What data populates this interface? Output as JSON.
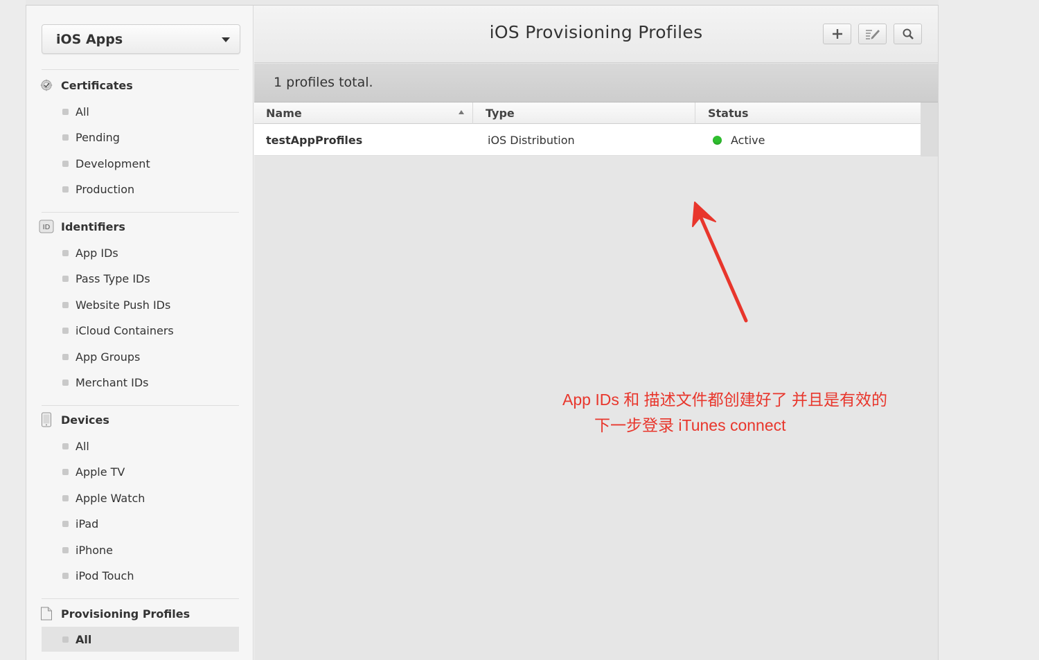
{
  "platform": {
    "selected": "iOS Apps"
  },
  "sidebar": {
    "sections": [
      {
        "title": "Certificates",
        "icon": "certificate-icon",
        "items": [
          "All",
          "Pending",
          "Development",
          "Production"
        ]
      },
      {
        "title": "Identifiers",
        "icon": "id-badge-icon",
        "icon_text": "ID",
        "items": [
          "App IDs",
          "Pass Type IDs",
          "Website Push IDs",
          "iCloud Containers",
          "App Groups",
          "Merchant IDs"
        ]
      },
      {
        "title": "Devices",
        "icon": "device-icon",
        "items": [
          "All",
          "Apple TV",
          "Apple Watch",
          "iPad",
          "iPhone",
          "iPod Touch"
        ]
      },
      {
        "title": "Provisioning Profiles",
        "icon": "document-icon",
        "items": [
          "All"
        ],
        "active_item": "All"
      }
    ]
  },
  "header": {
    "title": "iOS Provisioning Profiles",
    "buttons": [
      "plus-icon",
      "edit-icon",
      "search-icon"
    ]
  },
  "summary": {
    "text": "1 profiles total."
  },
  "table": {
    "columns": [
      "Name",
      "Type",
      "Status"
    ],
    "sorted_by": "Name",
    "rows": [
      {
        "name": "testAppProfiles",
        "type": "iOS Distribution",
        "status": "Active",
        "status_color": "#2fbf2f"
      }
    ]
  },
  "annotation": {
    "line1": "App IDs 和 描述文件都创建好了 并且是有效的",
    "line2": "下一步登录 iTunes connect",
    "color": "#e8362c"
  }
}
